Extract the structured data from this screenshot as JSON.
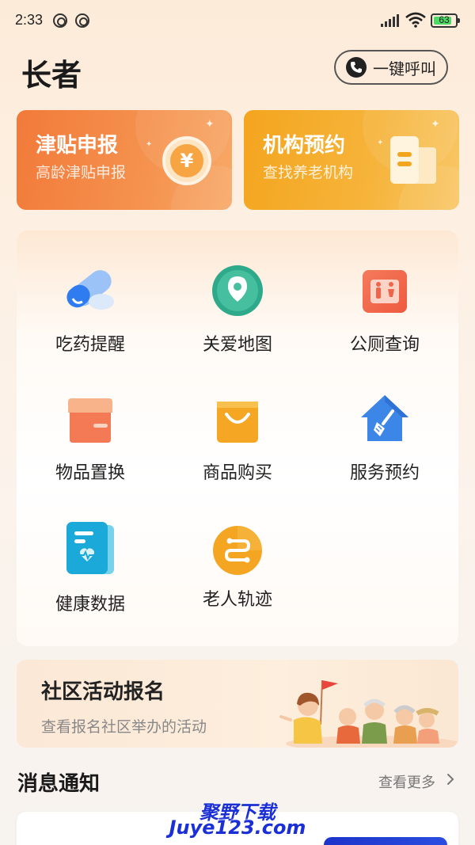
{
  "status_bar": {
    "time": "2:33",
    "battery": "63"
  },
  "header": {
    "title": "长者",
    "call_button_label": "一键呼叫"
  },
  "top_cards": [
    {
      "title": "津贴申报",
      "subtitle": "高龄津贴申报",
      "icon": "coin-icon",
      "icon_glyph": "¥"
    },
    {
      "title": "机构预约",
      "subtitle": "查找养老机构",
      "icon": "building-icon"
    }
  ],
  "services": [
    {
      "label": "吃药提醒",
      "icon": "pill-icon"
    },
    {
      "label": "关爱地图",
      "icon": "map-pin-icon"
    },
    {
      "label": "公厕查询",
      "icon": "restroom-icon"
    },
    {
      "label": "物品置换",
      "icon": "box-icon"
    },
    {
      "label": "商品购买",
      "icon": "shopping-bag-icon"
    },
    {
      "label": "服务预约",
      "icon": "house-broom-icon"
    },
    {
      "label": "健康数据",
      "icon": "health-report-icon"
    },
    {
      "label": "老人轨迹",
      "icon": "route-icon"
    }
  ],
  "community": {
    "title": "社区活动报名",
    "subtitle": "查看报名社区举办的活动"
  },
  "messages": {
    "title": "消息通知",
    "more_label": "查看更多"
  },
  "watermark": {
    "line1": "聚野下载",
    "line2": "Juye123.com"
  },
  "colors": {
    "subsidy_card": "#f27a3a",
    "institution_card": "#f4a51e",
    "watermark": "#1a2fd6"
  }
}
